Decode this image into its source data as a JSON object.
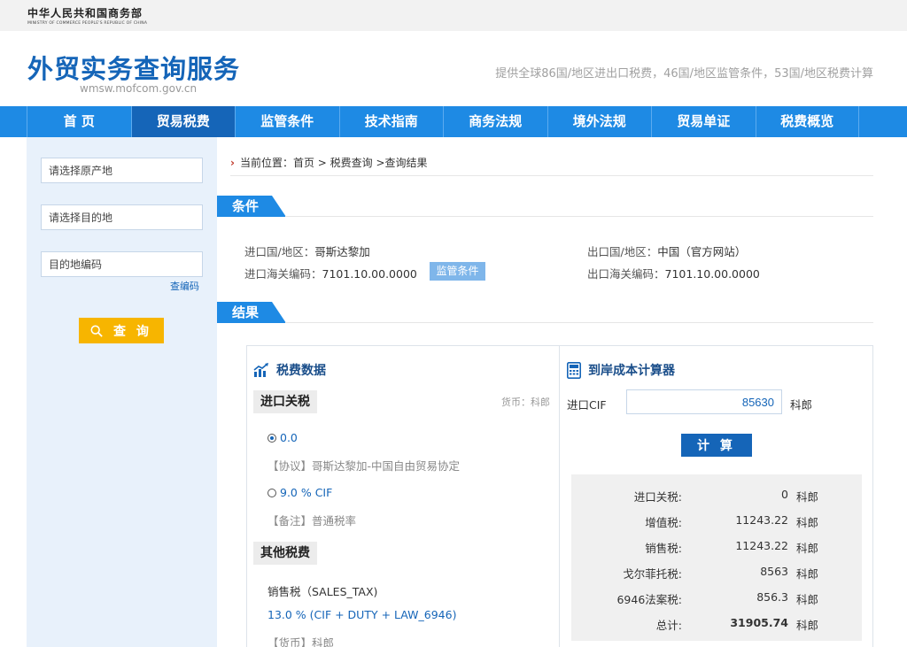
{
  "ministry": {
    "name_cn": "中华人民共和国商务部",
    "name_en": "MINISTRY OF COMMERCE PEOPLE'S REPUBLIC OF CHINA"
  },
  "header": {
    "title": "外贸实务查询服务",
    "domain": "wmsw.mofcom.gov.cn",
    "slogan": "提供全球86国/地区进出口税费，46国/地区监管条件，53国/地区税费计算"
  },
  "nav": {
    "items": [
      "首 页",
      "贸易税费",
      "监管条件",
      "技术指南",
      "商务法规",
      "境外法规",
      "贸易单证",
      "税费概览"
    ],
    "active": "贸易税费"
  },
  "sidebar": {
    "origin_placeholder": "请选择原产地",
    "destination_placeholder": "请选择目的地",
    "dest_code_placeholder": "目的地编码",
    "lookup_link": "查编码",
    "query_button": "查 询"
  },
  "breadcrumb": {
    "label": "当前位置：",
    "path": "首页 > 税费查询 >查询结果"
  },
  "conditions": {
    "section_title": "条件",
    "import_country_label": "进口国/地区：",
    "import_country": "哥斯达黎加",
    "export_country_label": "出口国/地区：",
    "export_country": "中国（官方网站）",
    "import_code_label": "进口海关编码：",
    "import_code": "7101.10.00.0000",
    "export_code_label": "出口海关编码：",
    "export_code": "7101.10.00.0000",
    "regulation_button": "监管条件"
  },
  "results": {
    "section_title": "结果",
    "tax_panel": {
      "title": "税费数据",
      "import_duty_label": "进口关税",
      "currency": "货币：科郎",
      "option1_value": "0.0",
      "option1_note": "【协议】哥斯达黎加-中国自由贸易协定",
      "option2_value": "9.0 % CIF",
      "option2_note": "【备注】普通税率",
      "other_taxes_label": "其他税费",
      "sales_tax_name": "销售税（SALES_TAX)",
      "sales_tax_formula": "13.0 % (CIF + DUTY + LAW_6946)",
      "sales_tax_currency": "【货币】科郎"
    },
    "calculator": {
      "title": "到岸成本计算器",
      "cif_label": "进口CIF",
      "cif_value": "85630",
      "unit": "科郎",
      "calc_button": "计 算",
      "rows": [
        {
          "label": "进口关税:",
          "value": "0",
          "unit": "科郎"
        },
        {
          "label": "增值税:",
          "value": "11243.22",
          "unit": "科郎"
        },
        {
          "label": "销售税:",
          "value": "11243.22",
          "unit": "科郎"
        },
        {
          "label": "戈尔菲托税:",
          "value": "8563",
          "unit": "科郎"
        },
        {
          "label": "6946法案税:",
          "value": "856.3",
          "unit": "科郎"
        },
        {
          "label": "总计:",
          "value": "31905.74",
          "unit": "科郎"
        }
      ]
    }
  }
}
